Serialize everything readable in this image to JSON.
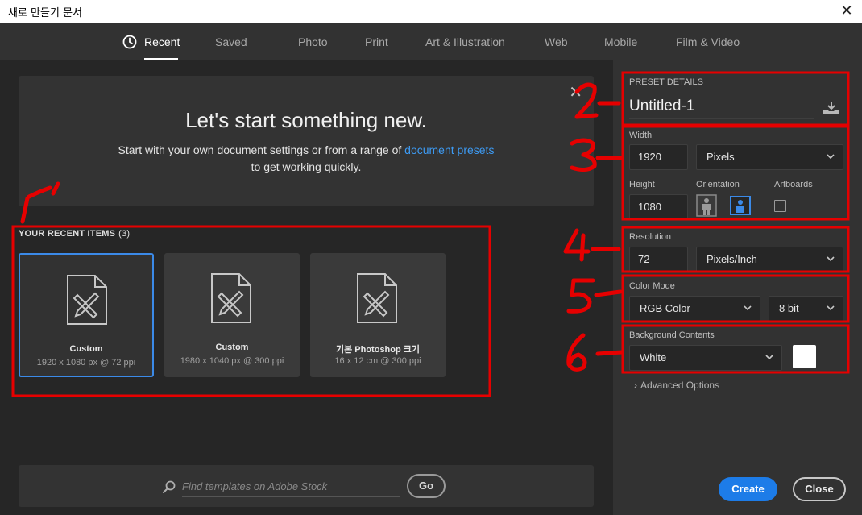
{
  "window": {
    "title": "새로 만들기 문서",
    "close_glyph": "✕"
  },
  "tabs": [
    {
      "label": "Recent",
      "active": true
    },
    {
      "label": "Saved"
    },
    {
      "label": "Photo"
    },
    {
      "label": "Print"
    },
    {
      "label": "Art & Illustration"
    },
    {
      "label": "Web"
    },
    {
      "label": "Mobile"
    },
    {
      "label": "Film & Video"
    }
  ],
  "hero": {
    "close_glyph": "✕",
    "title": "Let's start something new.",
    "text_before": "Start with your own document settings or from a range of ",
    "link": "document presets",
    "text_after": "to get working quickly."
  },
  "recent": {
    "label": "YOUR RECENT ITEMS",
    "count": "(3)",
    "items": [
      {
        "name": "Custom",
        "size": "1920 x 1080 px @ 72 ppi",
        "selected": true,
        "icon": "document-pencil-ruler-icon"
      },
      {
        "name": "Custom",
        "size": "1980 x 1040 px @ 300 ppi",
        "icon": "document-pencil-ruler-icon"
      },
      {
        "name": "기본 Photoshop 크기",
        "size": "16 x 12 cm @ 300 ppi",
        "icon": "document-pencil-ruler-icon"
      }
    ]
  },
  "search": {
    "placeholder": "Find templates on Adobe Stock",
    "go_label": "Go"
  },
  "preset": {
    "section_label": "PRESET DETAILS",
    "name": "Untitled-1",
    "width_label": "Width",
    "width_value": "1920",
    "width_unit": "Pixels",
    "height_label": "Height",
    "height_value": "1080",
    "orientation_label": "Orientation",
    "artboards_label": "Artboards",
    "resolution_label": "Resolution",
    "resolution_value": "72",
    "resolution_unit": "Pixels/Inch",
    "color_mode_label": "Color Mode",
    "color_mode_value": "RGB Color",
    "bit_depth_value": "8 bit",
    "background_label": "Background Contents",
    "background_value": "White",
    "background_color": "#ffffff",
    "advanced_label": "Advanced Options"
  },
  "buttons": {
    "create": "Create",
    "close": "Close"
  },
  "annotations": {
    "color": "#e60000",
    "labels": [
      "1",
      "2",
      "3",
      "4",
      "5",
      "6"
    ]
  },
  "colors": {
    "accent": "#1d7ce8",
    "link": "#3d9bf4",
    "annotation": "#e60000"
  }
}
